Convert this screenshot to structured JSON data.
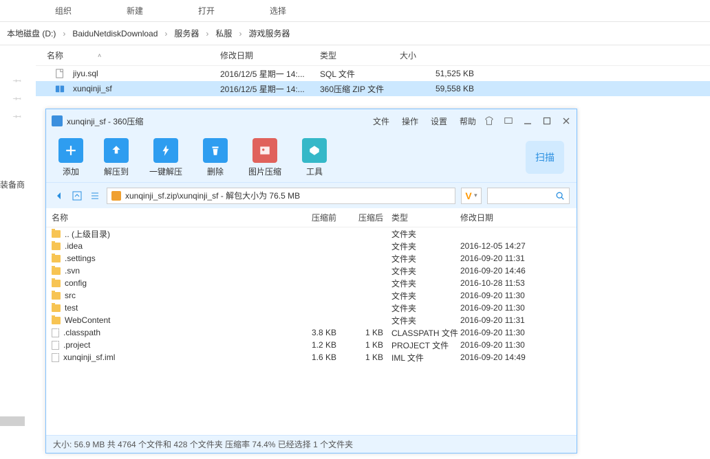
{
  "ribbon": {
    "tabs": [
      "组织",
      "新建",
      "打开",
      "选择"
    ]
  },
  "breadcrumb": [
    "本地磁盘 (D:)",
    "BaiduNetdiskDownload",
    "服务器",
    "私服",
    "游戏服务器"
  ],
  "explorer": {
    "headers": {
      "name": "名称",
      "date": "修改日期",
      "type": "类型",
      "size": "大小"
    },
    "rows": [
      {
        "name": "jiyu.sql",
        "date": "2016/12/5 星期一 14:...",
        "type": "SQL 文件",
        "size": "51,525 KB",
        "selected": false,
        "icon": "file"
      },
      {
        "name": "xunqinji_sf",
        "date": "2016/12/5 星期一 14:...",
        "type": "360压缩 ZIP 文件",
        "size": "59,558 KB",
        "selected": true,
        "icon": "zip"
      }
    ]
  },
  "pins_label": "装备商",
  "zip": {
    "title": "xunqinji_sf - 360压缩",
    "menus": [
      "文件",
      "操作",
      "设置",
      "帮助"
    ],
    "toolbar": [
      {
        "label": "添加",
        "color": "#2e9df0",
        "icon": "plus"
      },
      {
        "label": "解压到",
        "color": "#2e9df0",
        "icon": "up"
      },
      {
        "label": "一键解压",
        "color": "#2e9df0",
        "icon": "bolt"
      },
      {
        "label": "删除",
        "color": "#2e9df0",
        "icon": "trash"
      },
      {
        "label": "图片压缩",
        "color": "#e0625c",
        "icon": "image"
      },
      {
        "label": "工具",
        "color": "#35b8c8",
        "icon": "diamond"
      }
    ],
    "scan": "扫描",
    "path": "xunqinji_sf.zip\\xunqinji_sf - 解包大小为 76.5 MB",
    "headers": {
      "name": "名称",
      "before": "压缩前",
      "after": "压缩后",
      "type": "类型",
      "date": "修改日期"
    },
    "rows": [
      {
        "name": ".. (上级目录)",
        "before": "",
        "after": "",
        "type": "文件夹",
        "date": "",
        "icon": "folder"
      },
      {
        "name": ".idea",
        "before": "",
        "after": "",
        "type": "文件夹",
        "date": "2016-12-05 14:27",
        "icon": "folder"
      },
      {
        "name": ".settings",
        "before": "",
        "after": "",
        "type": "文件夹",
        "date": "2016-09-20 11:31",
        "icon": "folder"
      },
      {
        "name": ".svn",
        "before": "",
        "after": "",
        "type": "文件夹",
        "date": "2016-09-20 14:46",
        "icon": "folder"
      },
      {
        "name": "config",
        "before": "",
        "after": "",
        "type": "文件夹",
        "date": "2016-10-28 11:53",
        "icon": "folder"
      },
      {
        "name": "src",
        "before": "",
        "after": "",
        "type": "文件夹",
        "date": "2016-09-20 11:30",
        "icon": "folder"
      },
      {
        "name": "test",
        "before": "",
        "after": "",
        "type": "文件夹",
        "date": "2016-09-20 11:30",
        "icon": "folder"
      },
      {
        "name": "WebContent",
        "before": "",
        "after": "",
        "type": "文件夹",
        "date": "2016-09-20 11:31",
        "icon": "folder"
      },
      {
        "name": ".classpath",
        "before": "3.8 KB",
        "after": "1 KB",
        "type": "CLASSPATH 文件",
        "date": "2016-09-20 11:30",
        "icon": "file"
      },
      {
        "name": ".project",
        "before": "1.2 KB",
        "after": "1 KB",
        "type": "PROJECT 文件",
        "date": "2016-09-20 11:30",
        "icon": "file"
      },
      {
        "name": "xunqinji_sf.iml",
        "before": "1.6 KB",
        "after": "1 KB",
        "type": "IML 文件",
        "date": "2016-09-20 14:49",
        "icon": "file"
      }
    ],
    "status": "大小: 56.9 MB 共 4764 个文件和 428 个文件夹 压缩率 74.4% 已经选择 1 个文件夹"
  }
}
